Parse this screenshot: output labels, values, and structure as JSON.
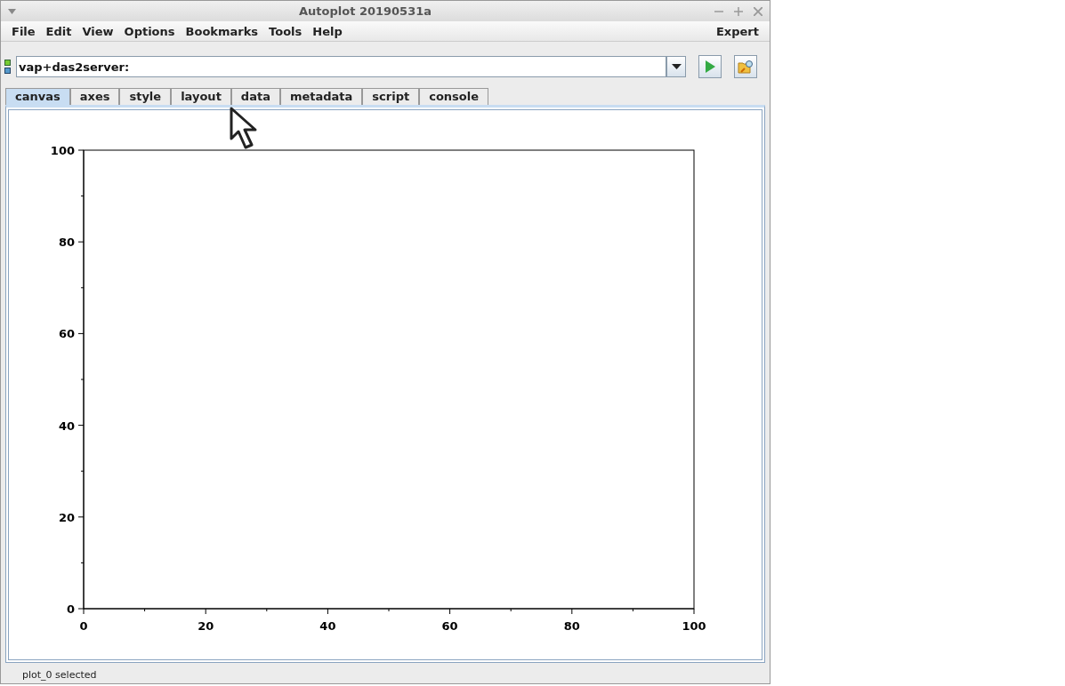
{
  "window": {
    "title": "Autoplot 20190531a"
  },
  "menu": [
    {
      "label": "File"
    },
    {
      "label": "Edit"
    },
    {
      "label": "View"
    },
    {
      "label": "Options"
    },
    {
      "label": "Bookmarks"
    },
    {
      "label": "Tools"
    },
    {
      "label": "Help"
    }
  ],
  "menu_right": "Expert",
  "address": {
    "value": "vap+das2server:"
  },
  "tabs": [
    {
      "label": "canvas",
      "selected": true
    },
    {
      "label": "axes",
      "selected": false
    },
    {
      "label": "style",
      "selected": false
    },
    {
      "label": "layout",
      "selected": false
    },
    {
      "label": "data",
      "selected": false
    },
    {
      "label": "metadata",
      "selected": false
    },
    {
      "label": "script",
      "selected": false
    },
    {
      "label": "console",
      "selected": false
    }
  ],
  "plot": {
    "chart_data": {
      "type": "line",
      "xlim": [
        0,
        100
      ],
      "ylim": [
        0,
        100
      ],
      "xticks": [
        0,
        20,
        40,
        60,
        80,
        100
      ],
      "yticks": [
        0,
        20,
        40,
        60,
        80,
        100
      ]
    }
  },
  "status_bar": "plot_0 selected"
}
